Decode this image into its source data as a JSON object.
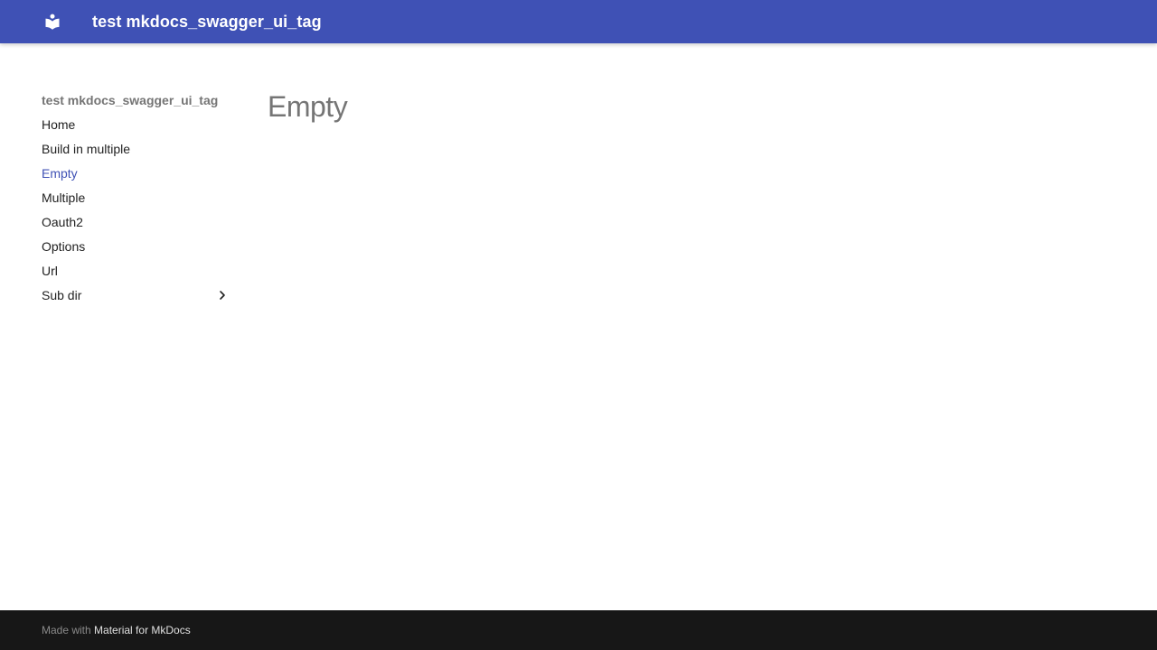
{
  "header": {
    "logo_icon": "book-icon",
    "site_title": "test mkdocs_swagger_ui_tag",
    "color": "#3f51b5"
  },
  "sidebar": {
    "title": "test mkdocs_swagger_ui_tag",
    "items": [
      {
        "label": "Home",
        "active": false
      },
      {
        "label": "Build in multiple",
        "active": false
      },
      {
        "label": "Empty",
        "active": true
      },
      {
        "label": "Multiple",
        "active": false
      },
      {
        "label": "Oauth2",
        "active": false
      },
      {
        "label": "Options",
        "active": false
      },
      {
        "label": "Url",
        "active": false
      },
      {
        "label": "Sub dir",
        "active": false,
        "icon": "chevron-right-icon"
      }
    ],
    "active_color": "#3f51b5"
  },
  "main": {
    "page_title": "Empty"
  },
  "footer": {
    "prefix": "Made with",
    "link_label": "Material for MkDocs",
    "background": "#171717"
  }
}
